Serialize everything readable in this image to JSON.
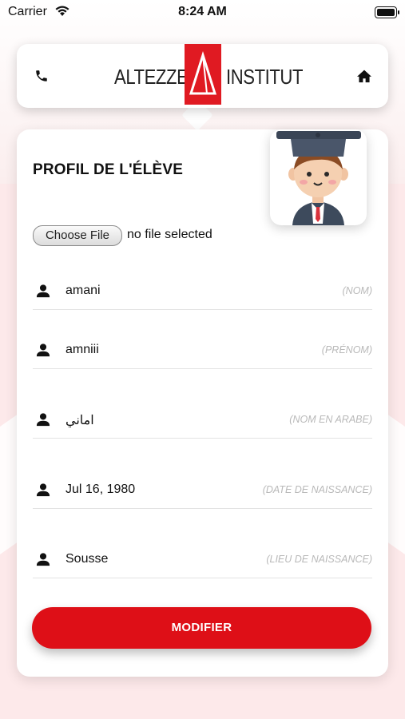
{
  "status_bar": {
    "carrier": "Carrier",
    "time": "8:24 AM"
  },
  "header": {
    "logo_left": "ALTEZZE",
    "logo_right": "INSTITUT",
    "accent": "#e01a22"
  },
  "profile": {
    "title": "PROFIL DE L'ÉLÈVE",
    "file_button": "Choose File",
    "file_status": "no file selected",
    "fields": [
      {
        "icon": "user-icon",
        "value": "amani",
        "placeholder": "(NOM)"
      },
      {
        "icon": "user-icon",
        "value": "amniii",
        "placeholder": "(PRÉNOM)"
      },
      {
        "icon": "user-icon",
        "value": "اماني",
        "placeholder": "(NOM EN ARABE)"
      },
      {
        "icon": "user-icon",
        "value": "Jul 16, 1980",
        "placeholder": "(DATE DE NAISSANCE)"
      },
      {
        "icon": "user-icon",
        "value": "Sousse",
        "placeholder": "(LIEU DE NAISSANCE)"
      }
    ],
    "submit_label": "MODIFIER"
  },
  "colors": {
    "primary": "#de0f17",
    "background": "#fde9ea"
  }
}
